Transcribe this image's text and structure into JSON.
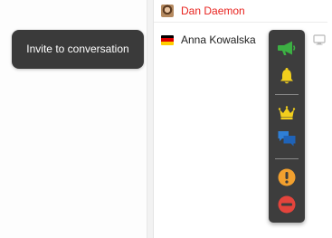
{
  "tooltip": {
    "text": "Invite to conversation"
  },
  "users": [
    {
      "name": "Dan Daemon",
      "color": "#e8231f",
      "icon": "avatar-icon"
    },
    {
      "name": "Anna Kowalska",
      "color": "#222222",
      "icon": "flag-germany-icon"
    }
  ],
  "action_menu": {
    "items": [
      {
        "icon": "megaphone-icon",
        "action": "invite",
        "color": "#3cb043",
        "highlighted": true
      },
      {
        "icon": "bell-icon",
        "action": "notify",
        "color": "#f2cf1d"
      },
      {
        "icon": "crown-icon",
        "action": "make-moderator",
        "color": "#f2cf1d"
      },
      {
        "icon": "chat-bubbles-icon",
        "action": "private-chat",
        "color": "#2f7fd6"
      },
      {
        "icon": "warning-icon",
        "action": "warn",
        "color": "#f2a02e"
      },
      {
        "icon": "block-icon",
        "action": "block",
        "color": "#e4443c"
      }
    ]
  },
  "colors": {
    "tooltip_bg": "#3a3a3a",
    "menu_bg": "#3d3d3d"
  }
}
